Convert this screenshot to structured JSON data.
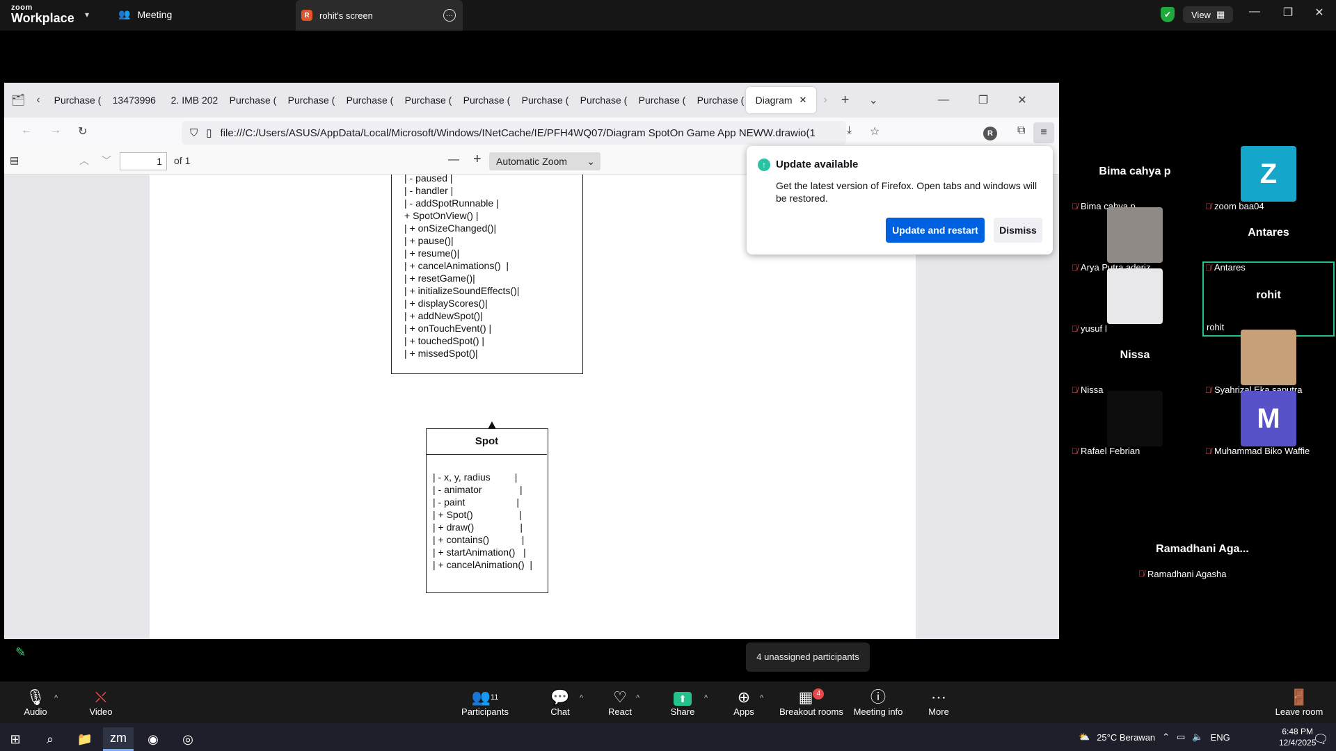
{
  "zoom": {
    "logo_small": "zoom",
    "logo_big": "Workplace",
    "meeting_tab": "Meeting",
    "screen_tab": "rohit's screen",
    "screen_tab_badge": "R",
    "view_label": "View"
  },
  "firefox": {
    "tabs": [
      "Purchase (",
      "13473996",
      "2. IMB 202",
      "Purchase (",
      "Purchase (",
      "Purchase (",
      "Purchase (",
      "Purchase (",
      "Purchase (",
      "Purchase (",
      "Purchase (",
      "Purchase ("
    ],
    "active_tab": "Diagram",
    "url": "file:///C:/Users/ASUS/AppData/Local/Microsoft/Windows/INetCache/IE/PFH4WQ07/Diagram SpotOn Game App NEWW.drawio(1",
    "profile_initial": "R"
  },
  "pdf": {
    "page_number": "1",
    "page_total": "of 1",
    "zoom": "Automatic Zoom"
  },
  "diagram": {
    "top_class_lines": [
      "| - paused |",
      "| - handler |",
      "| - addSpotRunnable |",
      "+ SpotOnView() |",
      "| + onSizeChanged()|",
      "| + pause()|",
      "| + resume()|",
      "| + cancelAnimations()  |",
      "| + resetGame()|",
      "| + initializeSoundEffects()|",
      "| + displayScores()|",
      "| + addNewSpot()|",
      "| + onTouchEvent() |",
      "| + touchedSpot() |",
      "| + missedSpot()|"
    ],
    "spot_title": "Spot",
    "spot_lines": [
      "| - x, y, radius         |",
      "| - animator              |",
      "| - paint                   |",
      "| + Spot()                 |",
      "| + draw()                 |",
      "| + contains()            |",
      "| + startAnimation()   |",
      "| + cancelAnimation()  |"
    ]
  },
  "update_popup": {
    "title": "Update available",
    "message": "Get the latest version of Firefox. Open tabs and windows will be restored.",
    "update_button": "Update and restart",
    "dismiss_button": "Dismiss"
  },
  "participants": [
    {
      "display": "Bima cahya p",
      "label": "Bima cahya p",
      "type": "name"
    },
    {
      "display": "Z",
      "label": "zoom baa04",
      "type": "avatar",
      "color": "#16a6c9"
    },
    {
      "display": "",
      "label": "Arya Putra aderiz",
      "type": "photo",
      "color": "#8f8a86"
    },
    {
      "display": "Antares",
      "label": "Antares",
      "type": "name"
    },
    {
      "display": "",
      "label": "yusuf I",
      "type": "photo",
      "color": "#e8e8ea"
    },
    {
      "display": "rohit",
      "label": "rohit",
      "type": "name",
      "active": true
    },
    {
      "display": "Nissa",
      "label": "Nissa",
      "type": "name"
    },
    {
      "display": "",
      "label": "Syahrizal Eka saputra",
      "type": "photo",
      "color": "#c7a07a"
    },
    {
      "display": "",
      "label": "Rafael Febrian",
      "type": "photo",
      "color": "#0d0d0d"
    },
    {
      "display": "M",
      "label": "Muhammad Biko Waffie",
      "type": "avatar",
      "color": "#5752c7"
    }
  ],
  "last_participant": {
    "display": "Ramadhani Aga...",
    "label": "Ramadhani Agasha"
  },
  "unassigned": "4 unassigned participants",
  "toolbar": {
    "audio": "Audio",
    "video": "Video",
    "participants": "Participants",
    "participants_count": "11",
    "chat": "Chat",
    "react": "React",
    "share": "Share",
    "apps": "Apps",
    "breakout": "Breakout rooms",
    "breakout_badge": "4",
    "meeting_info": "Meeting info",
    "more": "More",
    "leave": "Leave room"
  },
  "taskbar": {
    "weather": "25°C Berawan",
    "lang": "ENG",
    "time": "6:48 PM",
    "date": "12/4/2025"
  },
  "colors": {
    "zoom_accent": "#25c18b",
    "firefox_blue": "#0061e0",
    "share_green": "#25c18b"
  }
}
